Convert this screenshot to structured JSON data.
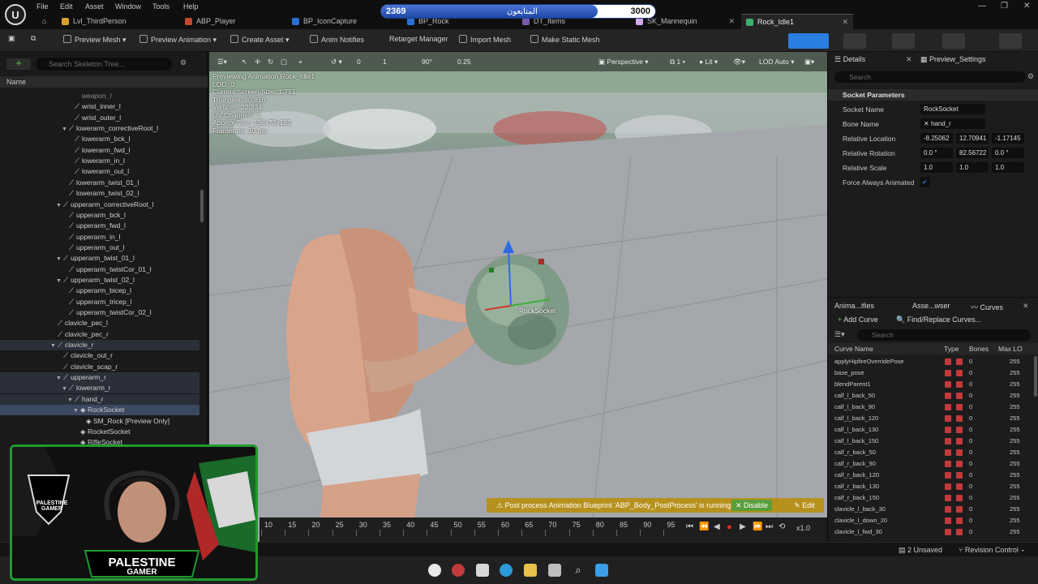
{
  "menubar": {
    "logo_glyph": "U",
    "items": [
      "File",
      "Edit",
      "Asset",
      "Window",
      "Tools",
      "Help"
    ],
    "window_controls": [
      "—",
      "❐",
      "✕"
    ]
  },
  "progress": {
    "current": "2369",
    "max": "3000",
    "label": "المتابعون",
    "fraction": 0.7897
  },
  "tabs": [
    {
      "label": "Lvl_ThirdPerson",
      "color": "#d4a22a",
      "active": false
    },
    {
      "label": "ABP_Player",
      "color": "#c24a2a",
      "active": false
    },
    {
      "label": "BP_IconCapture",
      "color": "#2a6fd4",
      "active": false
    },
    {
      "label": "BP_Rock",
      "color": "#2a6fd4",
      "active": false
    },
    {
      "label": "DT_Items",
      "color": "#7a5ab0",
      "active": false
    },
    {
      "label": "SK_Mannequin",
      "color": "#d4a8e8",
      "active": false
    },
    {
      "label": "Rock_Idle1",
      "color": "#3ab06a",
      "active": true
    }
  ],
  "toolbar": {
    "preview_mesh": "Preview Mesh",
    "preview_animation": "Preview Animation",
    "create_asset": "Create Asset",
    "anim_notifies": "Anim Notifies",
    "retarget_manager": "Retarget Manager",
    "import_mesh": "Import Mesh",
    "make_static_mesh": "Make Static Mesh"
  },
  "skeleton": {
    "search_placeholder": "Search Skeleton Tree...",
    "column_name": "Name",
    "rows": [
      {
        "label": "weapon_l",
        "indent": 3,
        "caret": false,
        "bone": false,
        "italic": true
      },
      {
        "label": "wrist_inner_l",
        "indent": 3,
        "caret": false,
        "bone": true
      },
      {
        "label": "wrist_outer_l",
        "indent": 3,
        "caret": false,
        "bone": true
      },
      {
        "label": "lowerarm_correctiveRoot_l",
        "indent": 2,
        "caret": true,
        "bone": true
      },
      {
        "label": "lowerarm_bck_l",
        "indent": 3,
        "caret": false,
        "bone": true
      },
      {
        "label": "lowerarm_fwd_l",
        "indent": 3,
        "caret": false,
        "bone": true
      },
      {
        "label": "lowerarm_in_l",
        "indent": 3,
        "caret": false,
        "bone": true
      },
      {
        "label": "lowerarm_out_l",
        "indent": 3,
        "caret": false,
        "bone": true
      },
      {
        "label": "lowerarm_twist_01_l",
        "indent": 2,
        "caret": false,
        "bone": true
      },
      {
        "label": "lowerarm_twist_02_l",
        "indent": 2,
        "caret": false,
        "bone": true
      },
      {
        "label": "upperarm_correctiveRoot_l",
        "indent": 1,
        "caret": true,
        "bone": true
      },
      {
        "label": "upperarm_bck_l",
        "indent": 2,
        "caret": false,
        "bone": true
      },
      {
        "label": "upperarm_fwd_l",
        "indent": 2,
        "caret": false,
        "bone": true
      },
      {
        "label": "upperarm_in_l",
        "indent": 2,
        "caret": false,
        "bone": true
      },
      {
        "label": "upperarm_out_l",
        "indent": 2,
        "caret": false,
        "bone": true
      },
      {
        "label": "upperarm_twist_01_l",
        "indent": 1,
        "caret": true,
        "bone": true
      },
      {
        "label": "upperarm_twistCor_01_l",
        "indent": 2,
        "caret": false,
        "bone": true
      },
      {
        "label": "upperarm_twist_02_l",
        "indent": 1,
        "caret": true,
        "bone": true
      },
      {
        "label": "upperarm_bicep_l",
        "indent": 2,
        "caret": false,
        "bone": true
      },
      {
        "label": "upperarm_tricep_l",
        "indent": 2,
        "caret": false,
        "bone": true
      },
      {
        "label": "upperarm_twistCor_02_l",
        "indent": 2,
        "caret": false,
        "bone": true
      },
      {
        "label": "clavicle_pec_l",
        "indent": 0,
        "caret": false,
        "bone": true
      },
      {
        "label": "clavicle_pec_r",
        "indent": 0,
        "caret": false,
        "bone": true
      },
      {
        "label": "clavicle_r",
        "indent": 0,
        "caret": true,
        "bone": true,
        "hl": true
      },
      {
        "label": "clavicle_out_r",
        "indent": 1,
        "caret": false,
        "bone": true
      },
      {
        "label": "clavicle_scap_r",
        "indent": 1,
        "caret": false,
        "bone": true
      },
      {
        "label": "upperarm_r",
        "indent": 1,
        "caret": true,
        "bone": true,
        "hl": true
      },
      {
        "label": "lowerarm_r",
        "indent": 2,
        "caret": true,
        "bone": true,
        "hl": true
      },
      {
        "label": "hand_r",
        "indent": 3,
        "caret": true,
        "bone": true,
        "hl": true
      },
      {
        "label": "RockSocket",
        "indent": 4,
        "caret": true,
        "bone": false,
        "sel": true
      },
      {
        "label": "SM_Rock [Preview Only]",
        "indent": 5,
        "caret": false,
        "bone": false
      },
      {
        "label": "RocketSocket",
        "indent": 4,
        "caret": false,
        "bone": false
      },
      {
        "label": "RifleSocket",
        "indent": 4,
        "caret": false,
        "bone": false
      }
    ]
  },
  "viewport": {
    "perspective": "Perspective",
    "lit": "Lit",
    "lod": "LOD Auto",
    "angle": "90°",
    "scale": "0.25",
    "grid_count": "1",
    "rot_count": "0",
    "stats": [
      "Previewing Animation Rock_Idle1",
      "LOD: 0",
      "Current Screen Size: 1.751",
      "Triangles: 60,816",
      "Vertices: 32,334",
      "UV Channels: 1",
      "Approx Size: 108x73x185",
      "Framerate: 30 fps"
    ],
    "socket_label": "RockSocket",
    "notification": "Post process Animation Blueprint 'ABP_Body_PostProcess' is running.",
    "disable_label": "Disable",
    "edit_label": "Edit"
  },
  "timeline": {
    "ticks": [
      "10",
      "15",
      "20",
      "25",
      "30",
      "35",
      "40",
      "45",
      "50",
      "55",
      "60",
      "65",
      "70",
      "75",
      "80",
      "85",
      "90",
      "95"
    ],
    "speed": "x1.0"
  },
  "details": {
    "tab_details": "Details",
    "tab_preview": "Preview_Settings",
    "search_placeholder": "Search",
    "section": "Socket Parameters",
    "socket_name_label": "Socket Name",
    "socket_name": "RockSocket",
    "bone_name_label": "Bone Name",
    "bone_name": "hand_r",
    "rel_location_label": "Relative Location",
    "rel_location": [
      "-8.25062",
      "12.70941",
      "-1.17145"
    ],
    "rel_rotation_label": "Relative Rotation",
    "rel_rotation": [
      "0.0 °",
      "82.56722",
      "0.0 °"
    ],
    "rel_scale_label": "Relative Scale",
    "rel_scale": [
      "1.0",
      "1.0",
      "1.0"
    ],
    "force_animated_label": "Force Always Animated"
  },
  "curves": {
    "tab1": "Anima...ifies",
    "tab2": "Asse...wser",
    "tab3": "Curves",
    "add_curve": "Add Curve",
    "find_replace": "Find/Replace Curves...",
    "search_placeholder": "Search",
    "col_name": "Curve Name",
    "col_type": "Type",
    "col_bones": "Bones",
    "col_max": "Max LO",
    "rows": [
      {
        "name": "applyHipfireOverridePose",
        "bones": "0",
        "max": "255"
      },
      {
        "name": "base_pose",
        "bones": "0",
        "max": "255"
      },
      {
        "name": "blendParent1",
        "bones": "0",
        "max": "255"
      },
      {
        "name": "calf_l_back_50",
        "bones": "0",
        "max": "255"
      },
      {
        "name": "calf_l_back_90",
        "bones": "0",
        "max": "255"
      },
      {
        "name": "calf_l_back_120",
        "bones": "0",
        "max": "255"
      },
      {
        "name": "calf_l_back_130",
        "bones": "0",
        "max": "255"
      },
      {
        "name": "calf_l_back_150",
        "bones": "0",
        "max": "255"
      },
      {
        "name": "calf_r_back_50",
        "bones": "0",
        "max": "255"
      },
      {
        "name": "calf_r_back_90",
        "bones": "0",
        "max": "255"
      },
      {
        "name": "calf_r_back_120",
        "bones": "0",
        "max": "255"
      },
      {
        "name": "calf_r_back_130",
        "bones": "0",
        "max": "255"
      },
      {
        "name": "calf_r_back_150",
        "bones": "0",
        "max": "255"
      },
      {
        "name": "clavicle_l_back_30",
        "bones": "0",
        "max": "255"
      },
      {
        "name": "clavicle_l_down_20",
        "bones": "0",
        "max": "255"
      },
      {
        "name": "clavicle_l_fwd_30",
        "bones": "0",
        "max": "255"
      }
    ]
  },
  "statusbar": {
    "unsaved": "2 Unsaved",
    "revision": "Revision Control"
  },
  "webcam": {
    "top_text": "PALESTINE GAMER",
    "bottom_line1": "PALESTINE",
    "bottom_line2": "GAMER"
  }
}
